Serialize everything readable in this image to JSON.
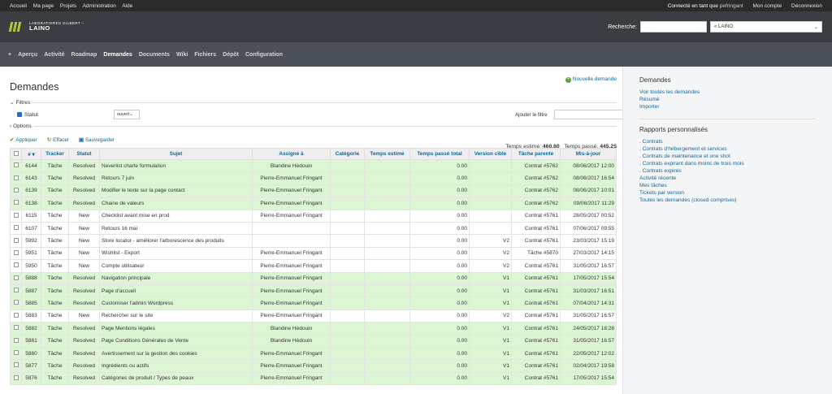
{
  "topbar": {
    "links": [
      "Accueil",
      "Ma page",
      "Projets",
      "Administration",
      "Aide"
    ],
    "logged_as_label": "Connecté en tant que",
    "user": "pefringant",
    "my_account": "Mon compte",
    "logout": "Déconnexion"
  },
  "header": {
    "logo_small": "LABORATOIRES GILBERT –",
    "logo_big": "LAINO",
    "search_label": "Recherche:",
    "project_select": "« LAINO"
  },
  "menu": {
    "plus": "+",
    "items": [
      "Aperçu",
      "Activité",
      "Roadmap",
      "Demandes",
      "Documents",
      "Wiki",
      "Fichiers",
      "Dépôt",
      "Configuration"
    ],
    "selected": "Demandes"
  },
  "main": {
    "title": "Demandes",
    "new_issue": "Nouvelle demande",
    "filters_label": "Filtres",
    "status_label": "Statut",
    "status_operator": "ouvert",
    "add_filter_label": "Ajouter le filtre",
    "options_label": "Options",
    "apply": "Appliquer",
    "clear": "Effacer",
    "save": "Sauvegarder",
    "estimated_label": "Temps estimé:",
    "estimated_value": "460.60",
    "spent_label": "Temps passé:",
    "spent_value": "445.25"
  },
  "table": {
    "headers": [
      "#",
      "Tracker",
      "Statut",
      "Sujet",
      "Assigné à",
      "Catégorie",
      "Temps estimé",
      "Temps passé total",
      "Version cible",
      "Tâche parente",
      "Mis-à-jour"
    ],
    "rows": [
      {
        "id": "6144",
        "tracker": "Tâche",
        "status": "Resolved",
        "subject": "Neverlist charte formulation",
        "assignee": "Blandine Hédouin",
        "category": "",
        "estimated": "",
        "spent": "0.00",
        "version": "",
        "parent": "Contrat #5762",
        "updated": "08/06/2017 12:00"
      },
      {
        "id": "6143",
        "tracker": "Tâche",
        "status": "Resolved",
        "subject": "Retours 7 juin",
        "assignee": "Pierre-Emmanuel Fringant",
        "category": "",
        "estimated": "",
        "spent": "0.00",
        "version": "",
        "parent": "Contrat #5762",
        "updated": "08/06/2017 16:54"
      },
      {
        "id": "6139",
        "tracker": "Tâche",
        "status": "Resolved",
        "subject": "Modifier le texte sur la page contact",
        "assignee": "Pierre-Emmanuel Fringant",
        "category": "",
        "estimated": "",
        "spent": "0.00",
        "version": "",
        "parent": "Contrat #5762",
        "updated": "08/06/2017 10:01"
      },
      {
        "id": "6138",
        "tracker": "Tâche",
        "status": "Resolved",
        "subject": "Chaine de valeurs",
        "assignee": "Pierre-Emmanuel Fringant",
        "category": "",
        "estimated": "",
        "spent": "0.00",
        "version": "",
        "parent": "Contrat #5762",
        "updated": "09/06/2017 11:29"
      },
      {
        "id": "6115",
        "tracker": "Tâche",
        "status": "New",
        "subject": "Checklist avant mise en prod",
        "assignee": "Pierre-Emmanuel Fringant",
        "category": "",
        "estimated": "",
        "spent": "0.00",
        "version": "",
        "parent": "Contrat #5761",
        "updated": "28/05/2017 00:52"
      },
      {
        "id": "6107",
        "tracker": "Tâche",
        "status": "New",
        "subject": "Retours 16 mai",
        "assignee": "",
        "category": "",
        "estimated": "",
        "spent": "0.00",
        "version": "",
        "parent": "Contrat #5761",
        "updated": "07/06/2017 09:55"
      },
      {
        "id": "5992",
        "tracker": "Tâche",
        "status": "New",
        "subject": "Store locator - améliorer l'arborescence des produits",
        "assignee": "",
        "category": "",
        "estimated": "",
        "spent": "0.00",
        "version": "V2",
        "parent": "Contrat #5761",
        "updated": "23/03/2017 15:19"
      },
      {
        "id": "5951",
        "tracker": "Tâche",
        "status": "New",
        "subject": "Wishlist - Export",
        "assignee": "Pierre-Emmanuel Fringant",
        "category": "",
        "estimated": "",
        "spent": "0.00",
        "version": "V2",
        "parent": "Tâche #5870",
        "updated": "27/03/2017 14:15"
      },
      {
        "id": "5950",
        "tracker": "Tâche",
        "status": "New",
        "subject": "Compte utilisateur",
        "assignee": "Pierre-Emmanuel Fringant",
        "category": "",
        "estimated": "",
        "spent": "0.00",
        "version": "V2",
        "parent": "Contrat #5761",
        "updated": "31/05/2017 16:57"
      },
      {
        "id": "5888",
        "tracker": "Tâche",
        "status": "Resolved",
        "subject": "Navigation principale",
        "assignee": "Pierre-Emmanuel Fringant",
        "category": "",
        "estimated": "",
        "spent": "0.00",
        "version": "V1",
        "parent": "Contrat #5761",
        "updated": "17/05/2017 15:54"
      },
      {
        "id": "5887",
        "tracker": "Tâche",
        "status": "Resolved",
        "subject": "Page d'accueil",
        "assignee": "Pierre-Emmanuel Fringant",
        "category": "",
        "estimated": "",
        "spent": "0.00",
        "version": "V1",
        "parent": "Contrat #5761",
        "updated": "31/03/2017 16:51"
      },
      {
        "id": "5885",
        "tracker": "Tâche",
        "status": "Resolved",
        "subject": "Customiser l'admin Wordpress",
        "assignee": "Pierre-Emmanuel Fringant",
        "category": "",
        "estimated": "",
        "spent": "0.00",
        "version": "V1",
        "parent": "Contrat #5761",
        "updated": "07/04/2017 14:31"
      },
      {
        "id": "5883",
        "tracker": "Tâche",
        "status": "New",
        "subject": "Rechercher sur le site",
        "assignee": "Pierre-Emmanuel Fringant",
        "category": "",
        "estimated": "",
        "spent": "0.00",
        "version": "V2",
        "parent": "Contrat #5761",
        "updated": "31/05/2017 16:57"
      },
      {
        "id": "5882",
        "tracker": "Tâche",
        "status": "Resolved",
        "subject": "Page Mentions légales",
        "assignee": "Blandine Hédouin",
        "category": "",
        "estimated": "",
        "spent": "0.00",
        "version": "V1",
        "parent": "Contrat #5761",
        "updated": "24/05/2017 18:28"
      },
      {
        "id": "5881",
        "tracker": "Tâche",
        "status": "Resolved",
        "subject": "Page Conditions Générales de Vente",
        "assignee": "Blandine Hédouin",
        "category": "",
        "estimated": "",
        "spent": "0.00",
        "version": "V1",
        "parent": "Contrat #5761",
        "updated": "31/05/2017 16:57"
      },
      {
        "id": "5880",
        "tracker": "Tâche",
        "status": "Resolved",
        "subject": "Avertissement sur la gestion des cookies",
        "assignee": "Pierre-Emmanuel Fringant",
        "category": "",
        "estimated": "",
        "spent": "0.00",
        "version": "V1",
        "parent": "Contrat #5761",
        "updated": "22/05/2017 12:02"
      },
      {
        "id": "5877",
        "tracker": "Tâche",
        "status": "Resolved",
        "subject": "Ingrédients ou actifs",
        "assignee": "Pierre-Emmanuel Fringant",
        "category": "",
        "estimated": "",
        "spent": "0.00",
        "version": "V1",
        "parent": "Contrat #5761",
        "updated": "02/04/2017 19:58"
      },
      {
        "id": "5876",
        "tracker": "Tâche",
        "status": "Resolved",
        "subject": "Catégories de produit / Types de peaux",
        "assignee": "Pierre-Emmanuel Fringant",
        "category": "",
        "estimated": "",
        "spent": "0.00",
        "version": "V1",
        "parent": "Contrat #5761",
        "updated": "17/05/2017 15:54"
      }
    ]
  },
  "sidebar": {
    "issues_title": "Demandes",
    "issues_links": [
      "Voir toutes les demandes",
      "Résumé",
      "Importer"
    ],
    "reports_title": "Rapports personnalisés",
    "reports_links": [
      ". Contrats",
      ". Contrats d'hébergement et services",
      ". Contrats de maintenance et one shot",
      ". Contrats expirant dans moins de trois mois",
      ". Contrats expirés",
      "Activité récente",
      "Mes tâches",
      "Tickets par version",
      "Toutes les demandes (closed comprises)"
    ]
  }
}
